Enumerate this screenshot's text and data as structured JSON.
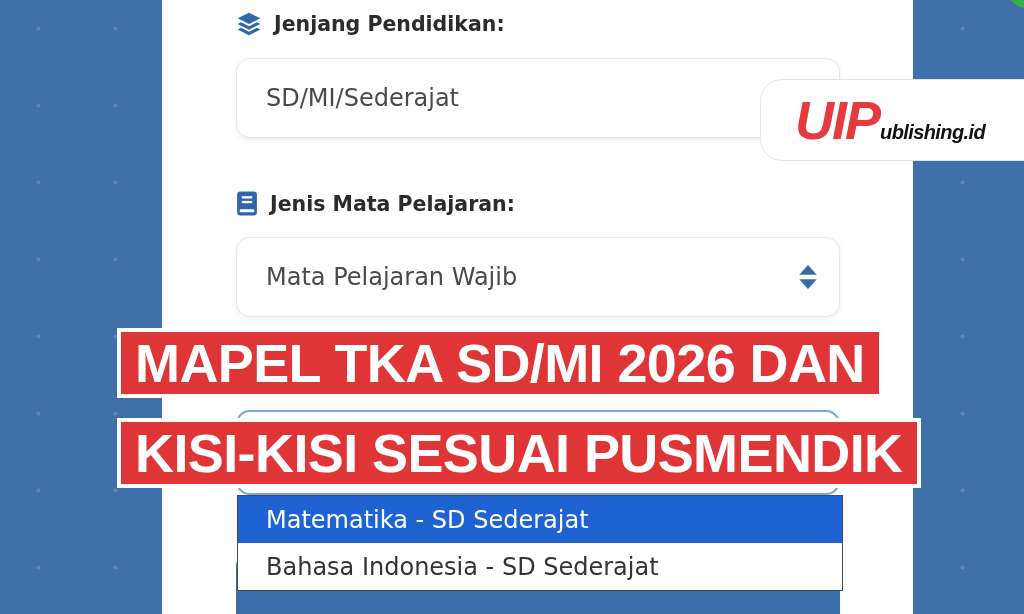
{
  "fields": [
    {
      "label": "Jenjang Pendidikan:",
      "kind": "input",
      "value": "SD/MI/Sederajat"
    },
    {
      "label": "Jenis Mata Pelajaran:",
      "kind": "select",
      "value": "Mata Pelajaran Wajib"
    }
  ],
  "subject_select": {
    "open": true,
    "options": [
      {
        "label": "Matematika - SD Sederajat",
        "selected": true
      },
      {
        "label": "Bahasa Indonesia - SD Sederajat",
        "selected": false
      }
    ]
  },
  "headline": [
    "MAPEL TKA SD/MI 2026 DAN",
    "KISI-KISI SESUAI PUSMENDIK"
  ],
  "logo": {
    "mark": "UIP",
    "text": "ublishing.id"
  }
}
